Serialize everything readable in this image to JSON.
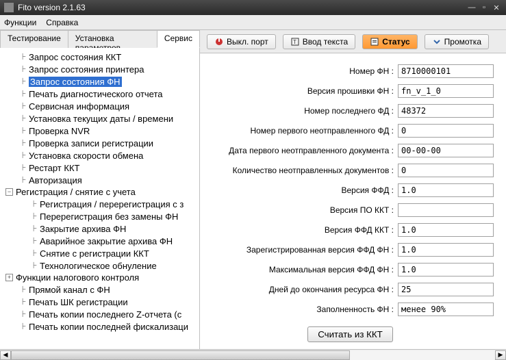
{
  "window": {
    "title": "Fito version 2.1.63"
  },
  "menu": {
    "functions": "Функции",
    "help": "Справка"
  },
  "tabs": {
    "testing": "Тестирование",
    "params": "Установка параметров",
    "service": "Сервис"
  },
  "toolbar": {
    "off_port": "Выкл. порт",
    "input_text": "Ввод текста",
    "status": "Статус",
    "scroll": "Промотка"
  },
  "tree": {
    "items": [
      {
        "label": "Запрос состояния ККТ"
      },
      {
        "label": "Запрос состояния принтера"
      },
      {
        "label": "Запрос состояния ФН",
        "selected": true
      },
      {
        "label": "Печать диагностического отчета"
      },
      {
        "label": "Сервисная информация"
      },
      {
        "label": "Установка текущих даты / времени"
      },
      {
        "label": "Проверка NVR"
      },
      {
        "label": "Проверка записи регистрации"
      },
      {
        "label": "Установка скорости обмена"
      },
      {
        "label": "Рестарт ККТ"
      },
      {
        "label": "Авторизация"
      }
    ],
    "reg_group": "Регистрация / снятие с учета",
    "reg_children": [
      {
        "label": "Регистрация / перерегистрация с з"
      },
      {
        "label": "Перерегистрация без замены ФН"
      },
      {
        "label": "Закрытие архива ФН"
      },
      {
        "label": "Аварийное закрытие архива ФН"
      },
      {
        "label": "Снятие с регистрации ККТ"
      },
      {
        "label": "Технологическое обнуление"
      }
    ],
    "tax_group": "Функции налогового контроля",
    "tail": [
      {
        "label": "Прямой канал с ФН"
      },
      {
        "label": "Печать ШК регистрации"
      },
      {
        "label": "Печать копии последнего Z-отчета (с"
      },
      {
        "label": "Печать копии последней фискализаци"
      }
    ]
  },
  "form": {
    "fn_number": {
      "label": "Номер ФН :",
      "value": "8710000101"
    },
    "fw_version": {
      "label": "Версия прошивки ФН :",
      "value": "fn_v_1_0"
    },
    "last_fd": {
      "label": "Номер последнего ФД :",
      "value": "48372"
    },
    "first_unsent": {
      "label": "Номер первого неотправленного ФД :",
      "value": "0"
    },
    "first_unsent_date": {
      "label": "Дата первого неотправленного документа :",
      "value": "00-00-00"
    },
    "unsent_count": {
      "label": "Количество неотправленных документов :",
      "value": "0"
    },
    "ffd_version": {
      "label": "Версия ФФД :",
      "value": "1.0"
    },
    "kkt_sw_version": {
      "label": "Версия ПО ККТ :",
      "value": ""
    },
    "ffd_kkt_version": {
      "label": "Версия ФФД ККТ :",
      "value": "1.0"
    },
    "reg_ffd_fn": {
      "label": "Зарегистрированная версия ФФД ФН :",
      "value": "1.0"
    },
    "max_ffd_fn": {
      "label": "Максимальная версия ФФД ФН :",
      "value": "1.0"
    },
    "days_left": {
      "label": "Дней до окончания ресурса ФН :",
      "value": "25"
    },
    "fill": {
      "label": "Заполненность ФН :",
      "value": "менее 90%"
    },
    "read_btn": "Считать из ККТ"
  }
}
